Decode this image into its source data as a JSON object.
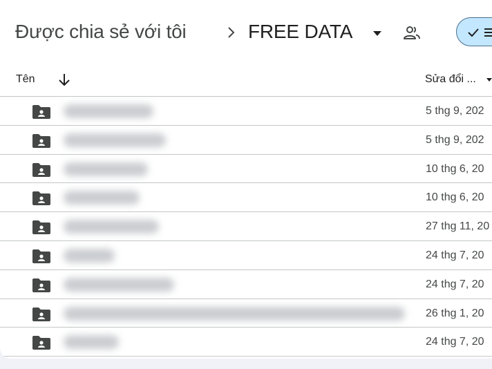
{
  "breadcrumb": {
    "root": "Được chia sẻ với tôi",
    "current": "FREE DATA"
  },
  "icons": {
    "separator": "chevron-right-icon",
    "dropdown": "caret-down-icon",
    "shared": "people-icon",
    "toggle_check": "check-icon",
    "toggle_list": "list-icon",
    "sort": "arrow-down-icon",
    "folder": "shared-folder-icon"
  },
  "columns": {
    "name": "Tên",
    "modified": "Sửa đổi ..."
  },
  "rows": [
    {
      "modified": "5 thg 9, 202"
    },
    {
      "modified": "5 thg 9, 202"
    },
    {
      "modified": "10 thg 6, 20"
    },
    {
      "modified": "10 thg 6, 20"
    },
    {
      "modified": "27 thg 11, 20"
    },
    {
      "modified": "24 thg 7, 20"
    },
    {
      "modified": "24 thg 7, 20"
    },
    {
      "modified": "26 thg 1, 20"
    },
    {
      "modified": "24 thg 7, 20"
    }
  ],
  "colors": {
    "toggle_bg": "#c2e7ff",
    "divider": "#c4c7c5",
    "folder": "#444746"
  }
}
